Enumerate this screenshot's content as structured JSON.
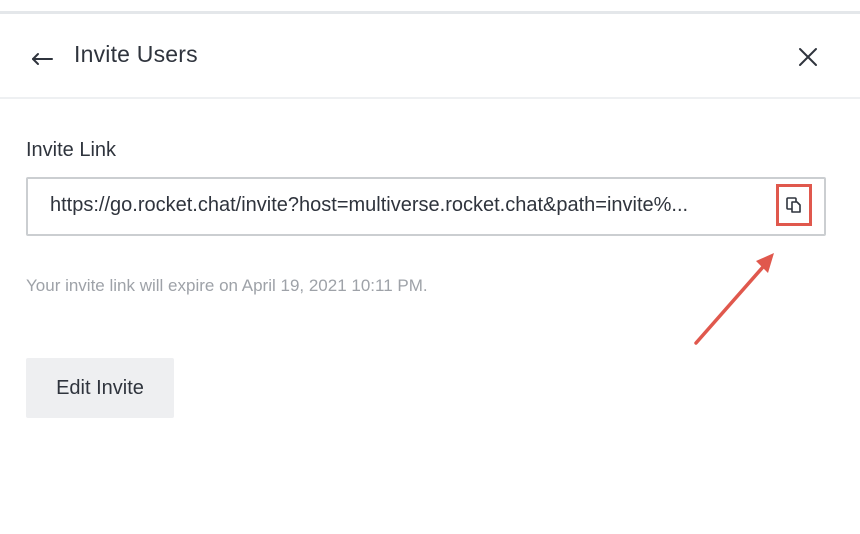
{
  "header": {
    "title": "Invite Users",
    "back_icon": "arrow-back-icon",
    "close_icon": "close-icon"
  },
  "invite": {
    "label": "Invite Link",
    "link_value": "https://go.rocket.chat/invite?host=multiverse.rocket.chat&path=invite%...",
    "copy_icon": "copy-icon",
    "expire_text": "Your invite link will expire on April 19, 2021 10:11 PM."
  },
  "actions": {
    "edit_invite_label": "Edit Invite"
  },
  "colors": {
    "annotation": "#e0584d",
    "text_primary": "#2f343d",
    "text_hint": "#9ea2a8",
    "button_bg": "#eeeff1"
  }
}
